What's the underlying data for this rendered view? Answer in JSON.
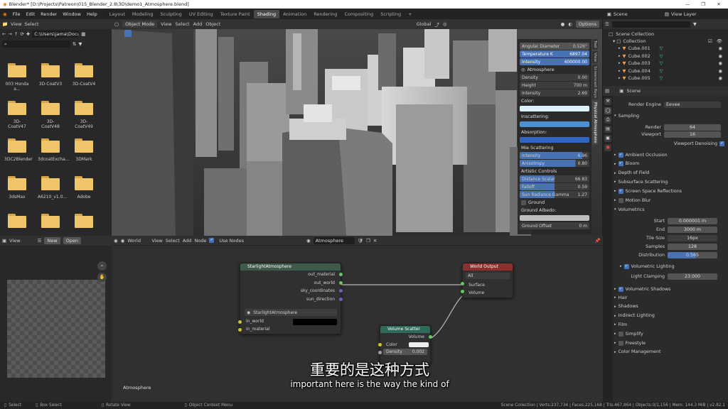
{
  "window": {
    "title": "Blender* [D:\\Projects\\Patreon\\015_Blender_2.8\\3D\\demo1_Atmosphere.blend]",
    "minimize": "—",
    "maximize": "❐",
    "close": "✕"
  },
  "menubar": {
    "menus": [
      "File",
      "Edit",
      "Render",
      "Window",
      "Help"
    ],
    "workspaces": [
      "Layout",
      "Modeling",
      "Sculpting",
      "UV Editing",
      "Texture Paint",
      "Shading",
      "Animation",
      "Rendering",
      "Compositing",
      "Scripting"
    ],
    "active_workspace": "Shading",
    "add": "+",
    "scene": "Scene",
    "view_layer": "View Layer"
  },
  "filebrowser": {
    "header": [
      "View",
      "Select"
    ],
    "path": "C:\\Users\\jama\\Docum...",
    "folders": [
      {
        "name": "003 Honda a..."
      },
      {
        "name": "3D-CoatV3"
      },
      {
        "name": "3D-CoatV4"
      },
      {
        "name": "3D-CoatV47"
      },
      {
        "name": "3D-CoatV48"
      },
      {
        "name": "3D-CoatV49"
      },
      {
        "name": "3DC2Blender"
      },
      {
        "name": "3dcoatExcha..."
      },
      {
        "name": "3DMark"
      },
      {
        "name": "3dsMax"
      },
      {
        "name": "A6210_v1.0..."
      },
      {
        "name": "Adobe"
      },
      {
        "name": ""
      },
      {
        "name": ""
      },
      {
        "name": ""
      }
    ]
  },
  "viewport": {
    "mode": "Object Mode",
    "menus": [
      "View",
      "Select",
      "Add",
      "Object"
    ],
    "orientation": "Global",
    "options": "Options",
    "tabs": [
      "Tool",
      "View",
      "Screencast Keys",
      "Physical Atmosphere"
    ]
  },
  "npanel": {
    "rows1": [
      {
        "label": "Angular Diameter",
        "value": "0.526°",
        "style": "gray"
      },
      {
        "label": "Temperature K",
        "value": "6897.04",
        "style": "blue"
      },
      {
        "label": "Intensity",
        "value": "400000.00",
        "style": "blue"
      }
    ],
    "atmosphere": "Atmosphere",
    "rows2": [
      {
        "label": "Density",
        "value": "0.00"
      },
      {
        "label": "Height",
        "value": "700 m"
      },
      {
        "label": "Intensity",
        "value": "2.69"
      }
    ],
    "color": "Color:",
    "inscattering": "Inscattering:",
    "absorption": "Absorption:",
    "mie": "Mie Scattering",
    "mie_rows": [
      {
        "label": "Intensity",
        "value": "6.96",
        "fill": 0.9
      },
      {
        "label": "Anisotropy",
        "value": "0.80",
        "fill": 0.8
      }
    ],
    "artistic": "Artistic Controls",
    "art_rows": [
      {
        "label": "Distance Scalar",
        "value": "66.83"
      },
      {
        "label": "Falloff",
        "value": "0.59"
      },
      {
        "label": "Sun Radiance Gamma",
        "value": "1.27"
      }
    ],
    "ground": "Ground",
    "ground_albedo": "Ground Albedo:",
    "ground_offset": {
      "label": "Ground Offset",
      "value": "0 m"
    }
  },
  "outliner": {
    "title": "Scene Collection",
    "collection": "Collection",
    "items": [
      "Cube.001",
      "Cube.002",
      "Cube.003",
      "Cube.004",
      "Cube.005"
    ]
  },
  "properties": {
    "scene": "Scene",
    "render_engine_label": "Render Engine",
    "render_engine": "Eevee",
    "sampling": "Sampling",
    "render_label": "Render",
    "render_val": "64",
    "viewport_label": "Viewport",
    "viewport_val": "16",
    "viewport_denoising": "Viewport Denoising",
    "sections": [
      "Ambient Occlusion",
      "Bloom",
      "Depth of Field",
      "Subsurface Scattering",
      "Screen Space Reflections",
      "Motion Blur"
    ],
    "volumetrics": "Volumetrics",
    "vol_rows": [
      {
        "label": "Start",
        "value": "0.000001 m"
      },
      {
        "label": "End",
        "value": "3000 m"
      },
      {
        "label": "Tile Size",
        "value": "16px"
      },
      {
        "label": "Samples",
        "value": "128"
      },
      {
        "label": "Distribution",
        "value": "0.565"
      }
    ],
    "vol_lighting": "Volumetric Lighting",
    "light_clamping_label": "Light Clamping",
    "light_clamping": "23.000",
    "vol_shadows": "Volumetric Shadows",
    "bottom_sections": [
      "Hair",
      "Shadows",
      "Indirect Lighting",
      "Film",
      "Simplify",
      "Freestyle",
      "Color Management"
    ]
  },
  "imageeditor": {
    "view": "View",
    "new": "New",
    "open": "Open"
  },
  "nodeeditor": {
    "type": "World",
    "menus": [
      "View",
      "Select",
      "Add",
      "Node"
    ],
    "use_nodes": "Use Nodes",
    "world_name": "Atmosphere",
    "footer": "Atmosphere",
    "node1": {
      "title": "StarlightAtmosphere",
      "outputs": [
        "out_material",
        "out_world",
        "sky_coordinates",
        "sun_direction"
      ],
      "group": "StarlightAtmosphere",
      "inputs": [
        "in_world",
        "in_material"
      ]
    },
    "node2": {
      "title": "World Output",
      "target": "All",
      "inputs": [
        "Surface",
        "Volume"
      ]
    },
    "node3": {
      "title": "Volume Scatter",
      "output": "Volume",
      "color": "Color",
      "density_label": "Density",
      "density": "0.002"
    }
  },
  "subtitles": {
    "chinese": "重要的是这种方式",
    "english": "important here is the way the kind of"
  },
  "status": {
    "select": "Select",
    "box_select": "Box Select",
    "rotate": "Rotate View",
    "context": "Object Context Menu",
    "stats": "Scene Collection | Verts:237,734 | Faces:225,168 | Tris:467,864 | Objects:0/1,156 | Mem: 144.3 MiB | v2.82.1"
  }
}
